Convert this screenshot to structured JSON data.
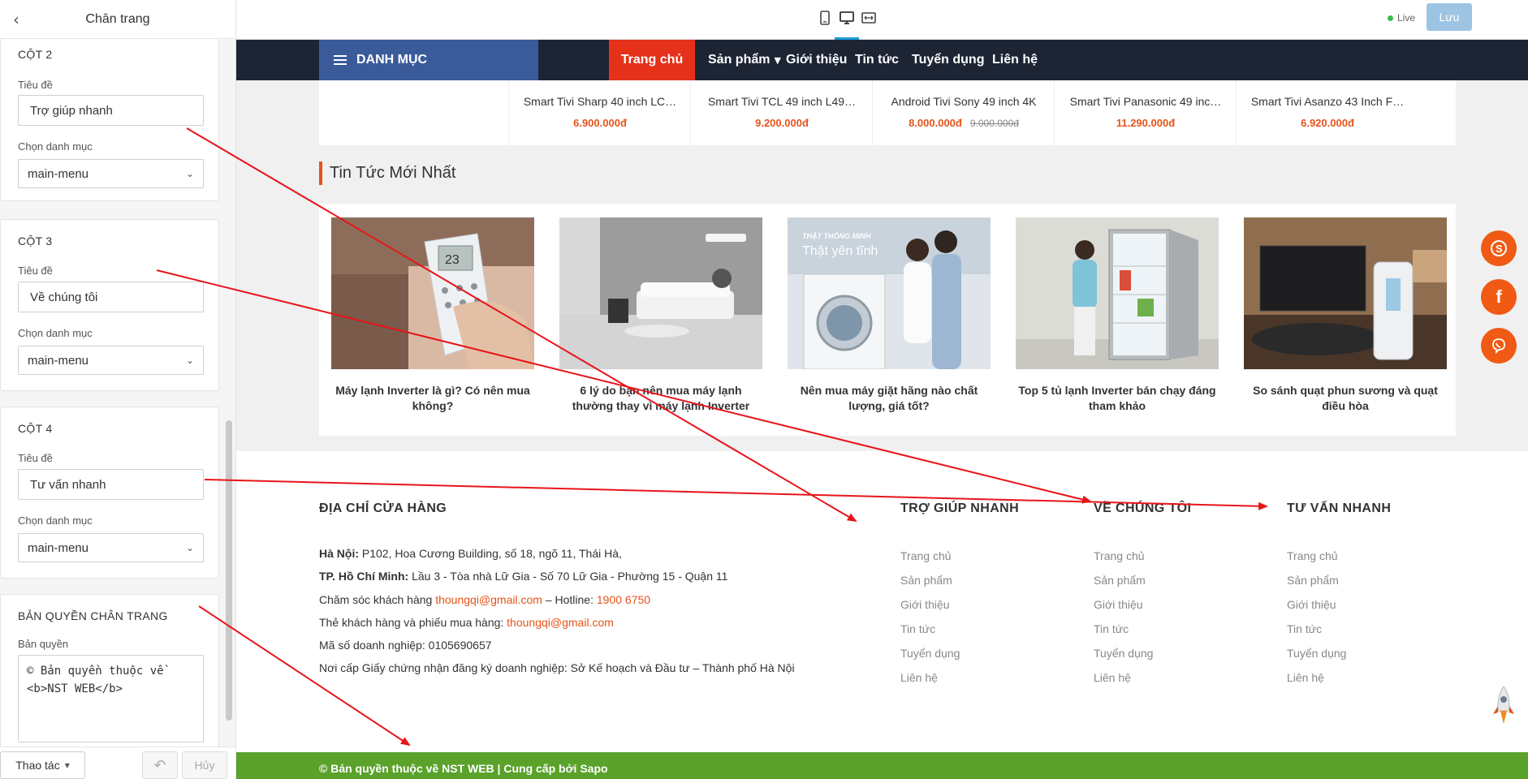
{
  "editor": {
    "panel_title": "Chân trang",
    "columns": [
      {
        "heading": "CỘT 2",
        "title_label": "Tiêu đề",
        "title_value": "Trợ giúp nhanh",
        "category_label": "Chọn danh mục",
        "category_value": "main-menu"
      },
      {
        "heading": "CỘT 3",
        "title_label": "Tiêu đề",
        "title_value": "Về chúng tôi",
        "category_label": "Chọn danh mục",
        "category_value": "main-menu"
      },
      {
        "heading": "CỘT 4",
        "title_label": "Tiêu đề",
        "title_value": "Tư vấn nhanh",
        "category_label": "Chọn danh mục",
        "category_value": "main-menu"
      }
    ],
    "copyright_section": {
      "heading": "BẢN QUYỀN CHÂN TRANG",
      "label": "Bản quyền",
      "value": "© Bản quyền thuộc về <b>NST WEB</b>"
    },
    "footer_bar": {
      "actions_label": "Thao tác",
      "cancel_label": "Hủy"
    }
  },
  "toolbar": {
    "live_label": "Live",
    "save_label": "Lưu"
  },
  "site": {
    "nav": {
      "category_label": "DANH MỤC",
      "items": [
        "Trang chủ",
        "Sản phẩm",
        "Giới thiệu",
        "Tin tức",
        "Tuyển dụng",
        "Liên hệ"
      ]
    },
    "products": [
      {
        "name": "Smart Tivi Sharp 40 inch LC…",
        "price": "6.900.000đ",
        "old_price": ""
      },
      {
        "name": "Smart Tivi TCL 49 inch L49…",
        "price": "9.200.000đ",
        "old_price": ""
      },
      {
        "name": "Android Tivi Sony 49 inch 4K",
        "price": "8.000.000đ",
        "old_price": "9.000.000đ"
      },
      {
        "name": "Smart Tivi Panasonic 49 inc…",
        "price": "11.290.000đ",
        "old_price": ""
      },
      {
        "name": "Smart Tivi Asanzo 43 Inch F…",
        "price": "6.920.000đ",
        "old_price": ""
      }
    ],
    "news_title": "Tin Tức Mới Nhất",
    "news": [
      {
        "caption": "Máy lạnh Inverter là gì? Có nên mua không?",
        "image": "remote-control-image"
      },
      {
        "caption": "6 lý do bạn nên mua máy lạnh thường thay vì máy lạnh Inverter",
        "image": "living-room-image"
      },
      {
        "caption": "Nên mua máy giặt hãng nào chất lượng, giá tốt?",
        "image": "washing-machine-image",
        "image_text_1": "THẬT THÔNG MINH",
        "image_text_2": "Thật yên tĩnh"
      },
      {
        "caption": "Top 5 tủ lạnh Inverter bán chạy đáng tham khảo",
        "image": "refrigerator-image"
      },
      {
        "caption": "So sánh quạt phun sương và quạt điều hòa",
        "image": "tv-and-fan-image"
      }
    ],
    "footer": {
      "address_heading": "ĐỊA CHỈ CỬA HÀNG",
      "hanoi_label": "Hà Nội:",
      "hanoi_address": " P102, Hoa Cương Building, số 18, ngõ 11, Thái Hà,",
      "hcm_label": "TP. Hồ Chí Minh:",
      "hcm_address": " Lầu 3 - Tòa nhà Lữ Gia - Số 70 Lữ Gia - Phường 15 - Quận 11",
      "care_prefix": "Chăm sóc khách hàng ",
      "care_email": "thoungqi@gmail.com",
      "hotline_prefix": " – Hotline: ",
      "hotline": "1900 6750",
      "card_prefix": "Thẻ khách hàng và phiếu mua hàng: ",
      "card_email": "thoungqi@gmail.com",
      "tax_id": "Mã số doanh nghiệp: 0105690657",
      "issued_by": "Nơi cấp Giấy chứng nhận đăng ký doanh nghiệp: Sở Kế hoạch và Đầu tư – Thành phố Hà Nội",
      "columns": [
        {
          "heading": "TRỢ GIÚP NHANH",
          "links": [
            "Trang chủ",
            "Sản phẩm",
            "Giới thiệu",
            "Tin tức",
            "Tuyển dụng",
            "Liên hệ"
          ]
        },
        {
          "heading": "VỀ CHÚNG TÔI",
          "links": [
            "Trang chủ",
            "Sản phẩm",
            "Giới thiệu",
            "Tin tức",
            "Tuyển dụng",
            "Liên hệ"
          ]
        },
        {
          "heading": "TƯ VẤN NHANH",
          "links": [
            "Trang chủ",
            "Sản phẩm",
            "Giới thiệu",
            "Tin tức",
            "Tuyển dụng",
            "Liên hệ"
          ]
        }
      ],
      "copyright": "© Bản quyền thuộc về NST WEB | Cung cấp bởi Sapo"
    }
  },
  "colors": {
    "nav_bg": "#1d2535",
    "nav_active": "#e5311a",
    "accent": "#e5531a",
    "copyright_bg": "#5aa22a",
    "arrow": "#e8141a",
    "float_btn": "#f05a14"
  }
}
